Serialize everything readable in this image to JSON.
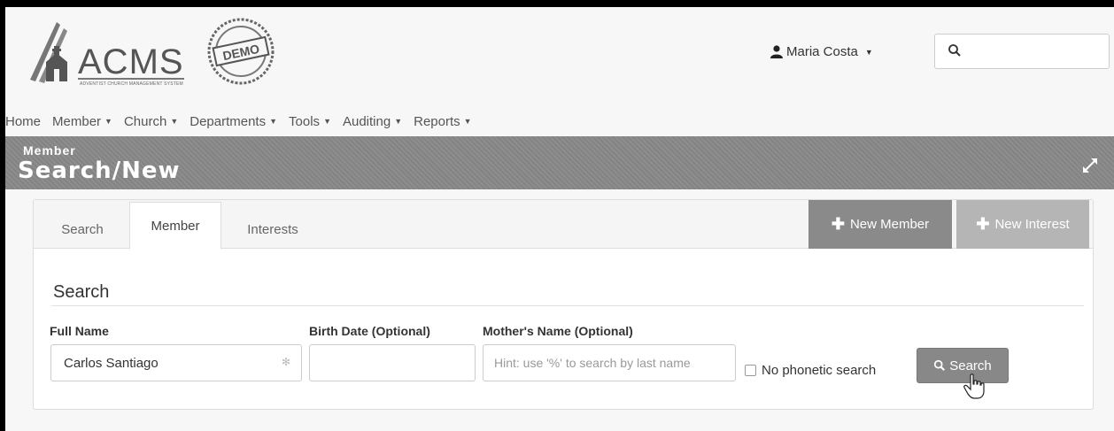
{
  "header": {
    "logo": {
      "brand": "ACMS",
      "tagline": "ADVENTIST CHURCH MANAGEMENT SYSTEM",
      "stamp_text": "DEMO"
    },
    "user": {
      "name": "Maria Costa",
      "icon": "user-icon"
    },
    "search": {
      "value": "",
      "icon": "search-icon"
    }
  },
  "nav": {
    "items": [
      {
        "label": "Home",
        "dropdown": false
      },
      {
        "label": "Member",
        "dropdown": true
      },
      {
        "label": "Church",
        "dropdown": true
      },
      {
        "label": "Departments",
        "dropdown": true
      },
      {
        "label": "Tools",
        "dropdown": true
      },
      {
        "label": "Auditing",
        "dropdown": true
      },
      {
        "label": "Reports",
        "dropdown": true
      }
    ]
  },
  "page": {
    "section": "Member",
    "title": "Search/New"
  },
  "tabs": [
    {
      "label": "Search",
      "active": false
    },
    {
      "label": "Member",
      "active": true
    },
    {
      "label": "Interests",
      "active": false
    }
  ],
  "actions": {
    "new_member": "New Member",
    "new_interest": "New Interest"
  },
  "form": {
    "heading": "Search",
    "full_name_label": "Full Name",
    "full_name_value": "Carlos Santiago",
    "birth_date_label": "Birth Date (Optional)",
    "birth_date_value": "",
    "mother_name_label": "Mother's Name (Optional)",
    "mother_name_placeholder": "Hint: use '%' to search by last name",
    "no_phonetic_label": "No phonetic search",
    "no_phonetic_checked": false,
    "search_button": "Search"
  },
  "colors": {
    "title_bar": "#888888",
    "new_member_bg": "#8a8a8a",
    "new_interest_bg": "#b5b5b5"
  }
}
